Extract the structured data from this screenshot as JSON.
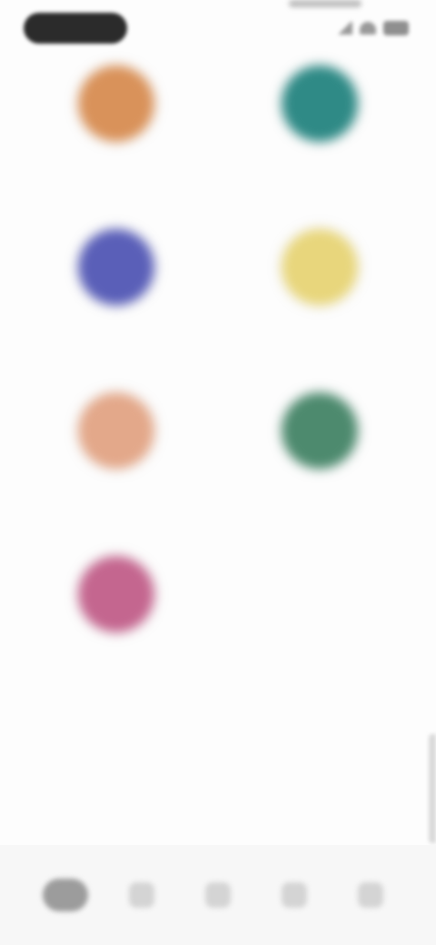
{
  "status_bar": {
    "time": "",
    "icons": [
      "signal-icon",
      "wifi-icon",
      "battery-icon"
    ]
  },
  "categories": [
    {
      "label": "",
      "color": "#d9925a"
    },
    {
      "label": "",
      "color": "#2f8a86"
    },
    {
      "label": "",
      "color": "#5a5fb8"
    },
    {
      "label": "",
      "color": "#e8d67c"
    },
    {
      "label": "",
      "color": "#e3a88a"
    },
    {
      "label": "",
      "color": "#4d8a6e"
    },
    {
      "label": "",
      "color": "#c4668f"
    }
  ],
  "bottom_nav": {
    "items": [
      {
        "icon": "home-icon",
        "active": true
      },
      {
        "icon": "search-icon",
        "active": false
      },
      {
        "icon": "grid-icon",
        "active": false
      },
      {
        "icon": "bookmark-icon",
        "active": false
      },
      {
        "icon": "profile-icon",
        "active": false
      }
    ]
  }
}
